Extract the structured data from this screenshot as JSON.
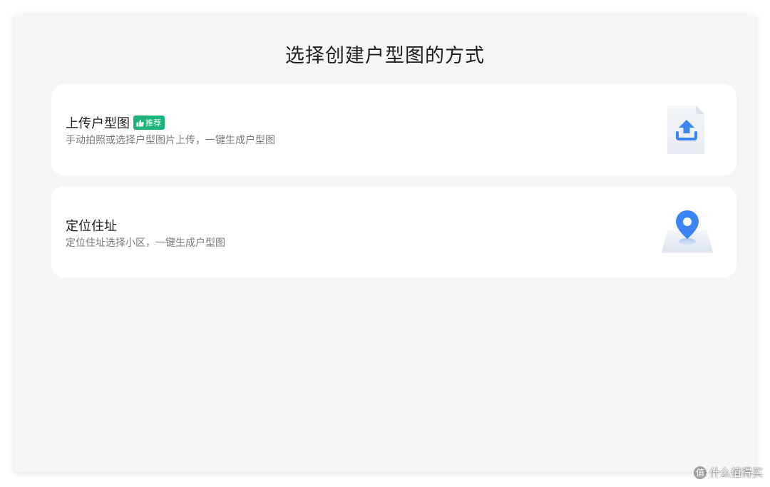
{
  "page": {
    "title": "选择创建户型图的方式"
  },
  "options": [
    {
      "title": "上传户型图",
      "badge": "推荐",
      "badge_icon": "thumbs-up-icon",
      "description": "手动拍照或选择户型图片上传，一键生成户型图",
      "icon": "upload-file-icon"
    },
    {
      "title": "定位住址",
      "description": "定位住址选择小区，一键生成户型图",
      "icon": "map-pin-icon"
    }
  ],
  "watermark": {
    "text": "什么值得买",
    "icon": "zhi-logo-icon"
  },
  "colors": {
    "badge_bg": "#1bb47a",
    "accent_blue": "#3a84f5",
    "panel_bg": "#f6f6f7"
  }
}
